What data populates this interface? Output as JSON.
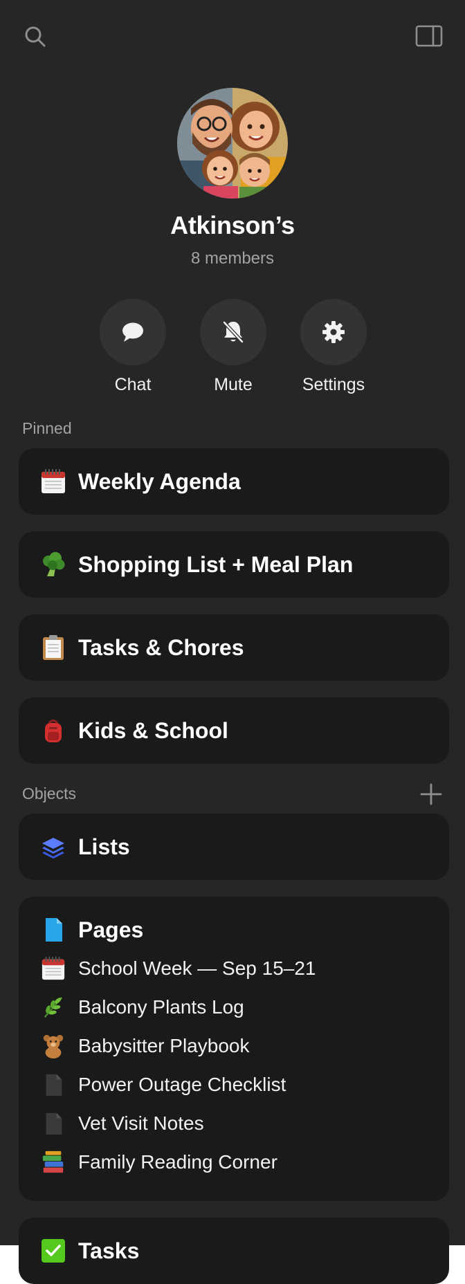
{
  "group": {
    "name": "Atkinson’s",
    "members": "8 members"
  },
  "actions": [
    {
      "label": "Chat",
      "icon": "chat-bubble-icon"
    },
    {
      "label": "Mute",
      "icon": "bell-slash-icon"
    },
    {
      "label": "Settings",
      "icon": "gear-icon"
    }
  ],
  "pinned": {
    "label": "Pinned",
    "items": [
      {
        "label": "Weekly Agenda",
        "icon": "calendar-icon"
      },
      {
        "label": "Shopping List + Meal Plan",
        "icon": "broccoli-icon"
      },
      {
        "label": "Tasks & Chores",
        "icon": "clipboard-icon"
      },
      {
        "label": "Kids & School",
        "icon": "backpack-icon"
      }
    ]
  },
  "objects": {
    "label": "Objects",
    "lists_label": "Lists",
    "pages_label": "Pages",
    "pages": [
      {
        "label": "School Week — Sep 15–21",
        "icon": "calendar-icon"
      },
      {
        "label": "Balcony Plants Log",
        "icon": "herb-icon"
      },
      {
        "label": "Babysitter Playbook",
        "icon": "teddy-bear-icon"
      },
      {
        "label": "Power Outage Checklist",
        "icon": "document-icon"
      },
      {
        "label": "Vet Visit Notes",
        "icon": "document-icon"
      },
      {
        "label": "Family Reading Corner",
        "icon": "books-icon"
      }
    ],
    "tasks_label": "Tasks"
  },
  "colors": {
    "background": "#262626",
    "card": "#1a1a1a",
    "button_circle": "#333333",
    "muted_text": "#a3a3a3",
    "lists_icon": "#4a6cf7",
    "pages_icon": "#29a3ea",
    "tasks_check": "#55c91d"
  }
}
